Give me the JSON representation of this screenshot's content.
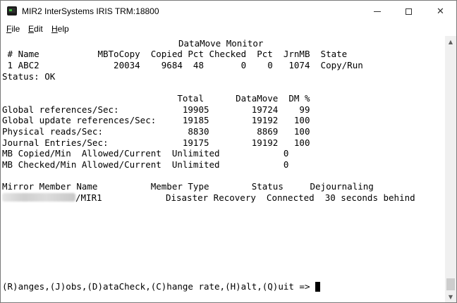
{
  "window": {
    "title": "MIR2 InterSystems IRIS TRM:18800"
  },
  "menu": [
    {
      "underlined": "F",
      "rest": "ile"
    },
    {
      "underlined": "E",
      "rest": "dit"
    },
    {
      "underlined": "H",
      "rest": "elp"
    }
  ],
  "terminal": {
    "monitor_title": "DataMove Monitor",
    "table_header": " # Name           MBToCopy  Copied Pct Checked  Pct  JrnMB  State",
    "table_row": " 1 ABC2              20034    9684  48       0    0   1074  Copy/Run",
    "status": "Status: OK",
    "stats_header": "                                 Total      DataMove  DM %",
    "stats": [
      "Global references/Sec:            19905        19724    99",
      "Global update references/Sec:     19185        19192   100",
      "Physical reads/Sec:                8830         8869   100",
      "Journal Entries/Sec:              19175        19192   100",
      "MB Copied/Min  Allowed/Current  Unlimited            0",
      "MB Checked/Min Allowed/Current  Unlimited            0"
    ],
    "mirror_header": "Mirror Member Name          Member Type        Status     Dejournaling",
    "mirror_member_suffix": "/MIR1",
    "mirror_member_rest": "            Disaster Recovery  Connected  30 seconds behind",
    "prompt": "(R)anges,(J)obs,(D)ataCheck,(C)hange rate,(H)alt,(Q)uit => "
  }
}
